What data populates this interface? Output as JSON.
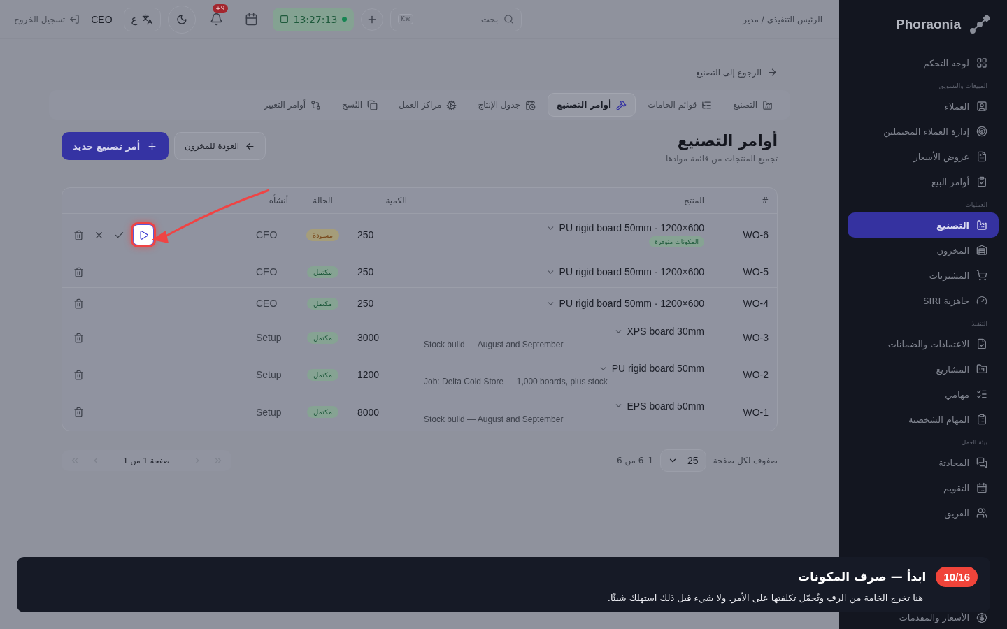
{
  "sidebar": {
    "brand": "Phoraonia",
    "sections": [
      {
        "items": [
          {
            "label": "لوحة التحكم",
            "selected": false
          }
        ]
      },
      {
        "title": "المبيعات والتسويق",
        "items": [
          {
            "label": "العملاء",
            "selected": false
          },
          {
            "label": "إدارة العملاء المحتملين",
            "selected": false
          },
          {
            "label": "عروض الأسعار",
            "selected": false
          },
          {
            "label": "أوامر البيع",
            "selected": false
          }
        ]
      },
      {
        "title": "العمليات",
        "items": [
          {
            "label": "التصنيع",
            "selected": true
          },
          {
            "label": "المخزون",
            "selected": false
          },
          {
            "label": "المشتريات",
            "selected": false
          },
          {
            "label": "جاهزية SIRI",
            "selected": false
          }
        ]
      },
      {
        "title": "التنفيذ",
        "items": [
          {
            "label": "الاعتمادات والضمانات",
            "selected": false
          },
          {
            "label": "المشاريع",
            "selected": false
          },
          {
            "label": "مهامي",
            "selected": false
          },
          {
            "label": "المهام الشخصية",
            "selected": false
          }
        ]
      },
      {
        "title": "بيئة العمل",
        "items": [
          {
            "label": "المحادثة",
            "selected": false
          },
          {
            "label": "التقويم",
            "selected": false
          },
          {
            "label": "الفريق",
            "selected": false
          },
          {
            "label": "الأسعار والمقدمات",
            "selected": false
          }
        ]
      }
    ]
  },
  "header": {
    "breadcrumb": "الرئيس التنفيذي / مدير",
    "search": {
      "placeholder": "بحث",
      "shortcut": "K⌘"
    },
    "timer": "13:27:13",
    "notifications": "+9",
    "language": "ع",
    "user": "CEO",
    "logout": "تسجيل الخروج"
  },
  "back_link": "الرجوع إلى التصنيع",
  "tabs": [
    {
      "label": "التصنيع",
      "selected": false
    },
    {
      "label": "قوائم الخامات",
      "selected": false
    },
    {
      "label": "أوامر التصنيع",
      "selected": true
    },
    {
      "label": "جدول الإنتاج",
      "selected": false
    },
    {
      "label": "مراكز العمل",
      "selected": false
    },
    {
      "label": "النُسخ",
      "selected": false
    },
    {
      "label": "أوامر التغيير",
      "selected": false
    }
  ],
  "page": {
    "title": "أوامر التصنيع",
    "subtitle": "تجميع المنتجات من قائمة موادها",
    "secondary_button": "العودة للمخزون",
    "primary_button": "أمر تصنيع جديد"
  },
  "table": {
    "columns": [
      "#",
      "المنتج",
      "الكمية",
      "الحالة",
      "أنشأه"
    ],
    "rows": [
      {
        "id": "WO-6",
        "product": "PU rigid board 50mm · 1200×600",
        "badge": "المكونات متوفرة",
        "quantity": "250",
        "status": {
          "label": "مسودة",
          "kind": "draft"
        },
        "creator": "CEO",
        "start_highlighted": true
      },
      {
        "id": "WO-5",
        "product": "PU rigid board 50mm · 1200×600",
        "quantity": "250",
        "status": {
          "label": "مكتمل",
          "kind": "done"
        },
        "creator": "CEO"
      },
      {
        "id": "WO-4",
        "product": "PU rigid board 50mm · 1200×600",
        "quantity": "250",
        "status": {
          "label": "مكتمل",
          "kind": "done"
        },
        "creator": "CEO"
      },
      {
        "id": "WO-3",
        "product": "XPS board 30mm",
        "note": "Stock build — August and September",
        "quantity": "3000",
        "status": {
          "label": "مكتمل",
          "kind": "done"
        },
        "creator": "Setup"
      },
      {
        "id": "WO-2",
        "product": "PU rigid board 50mm",
        "note": "Job: Delta Cold Store — 1,000 boards, plus stock",
        "quantity": "1200",
        "status": {
          "label": "مكتمل",
          "kind": "done"
        },
        "creator": "Setup"
      },
      {
        "id": "WO-1",
        "product": "EPS board 50mm",
        "note": "Stock build — August and September",
        "quantity": "8000",
        "status": {
          "label": "مكتمل",
          "kind": "done"
        },
        "creator": "Setup"
      }
    ]
  },
  "pagination": {
    "rows_label": "صفوف لكل صفحة",
    "page_size": "25",
    "range": "1–6 من 6",
    "page": "صفحة 1 من 1"
  },
  "tour": {
    "step": "10/16",
    "title": "ابدأ — صرف المكونات",
    "body": "هنا تخرج الخامة من الرف وتُحمّل تكلفتها على الأمر. ولا شيء قبل ذلك استهلك شيئًا."
  }
}
